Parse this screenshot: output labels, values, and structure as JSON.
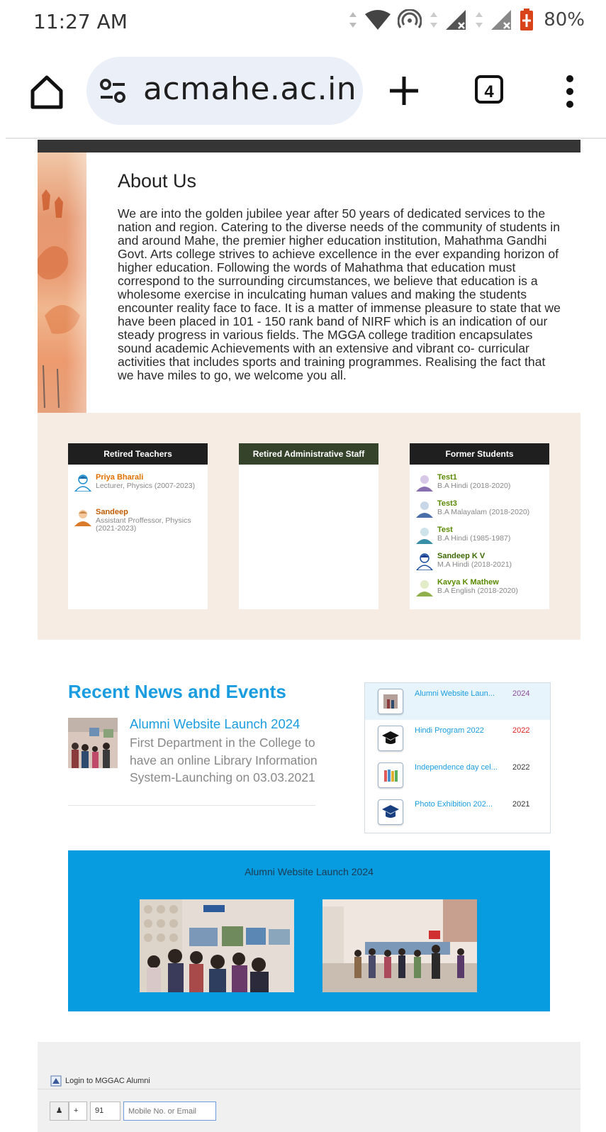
{
  "status_bar": {
    "time": "11:27 AM",
    "battery": "80%"
  },
  "browser": {
    "url": "acmahe.ac.in",
    "tab_count": "4"
  },
  "about": {
    "title": "About Us",
    "text": "We are into the golden jubilee year after 50 years of dedicated services to the nation and region. Catering to the diverse needs of the community of students in and around Mahe, the premier higher education institution, Mahathma Gandhi Govt. Arts college strives to achieve excellence in the ever expanding horizon of higher education. Following the words of Mahathma that education must correspond to the surrounding circumstances, we believe that education is a wholesome exercise in inculcating human values and making the students encounter reality face to face. It is a matter of immense pleasure to state that we have been placed in 101 - 150 rank band of NIRF which is an indication of our steady progress in various fields. The MGGA college tradition encapsulates sound academic Achievements with an extensive and vibrant co- curricular activities that includes sports and training programmes. Realising the fact that we have miles to go, we welcome you all."
  },
  "cards": [
    {
      "title": "Retired Teachers",
      "color": "#1f1f1f",
      "people": [
        {
          "name": "Priya Bharali",
          "desc": "Lecturer, Physics (2007-2023)",
          "name_color": "#e07000",
          "avatar": "female-avatar-icon"
        },
        {
          "name": "Sandeep",
          "desc": "Assistant Proffessor, Physics (2021-2023)",
          "name_color": "#c05a00",
          "avatar": "male-avatar-icon"
        }
      ]
    },
    {
      "title": "Retired Administrative Staff",
      "color": "#34432a",
      "people": []
    },
    {
      "title": "Former Students",
      "color": "#1f1f1f",
      "people": [
        {
          "name": "Test1",
          "desc": "B.A Hindi (2018-2020)",
          "name_color": "#5a8a00",
          "avatar": "male-avatar-icon"
        },
        {
          "name": "Test3",
          "desc": "B.A Malayalam (2018-2020)",
          "name_color": "#5a8a00",
          "avatar": "male-avatar-icon"
        },
        {
          "name": "Test",
          "desc": "B.A Hindi (1985-1987)",
          "name_color": "#5a8a00",
          "avatar": "male-avatar-icon"
        },
        {
          "name": "Sandeep K V",
          "desc": "M.A Hindi (2018-2021)",
          "name_color": "#3d6a00",
          "avatar": "female-avatar-icon"
        },
        {
          "name": "Kavya K Mathew",
          "desc": "B.A English (2018-2020)",
          "name_color": "#5a8a00",
          "avatar": "female-avatar-icon"
        }
      ]
    }
  ],
  "news": {
    "title": "Recent News and Events",
    "featured": {
      "headline": "Alumni Website Launch 2024",
      "description": "First Department in the College to have an online Library Information System-Launching on 03.03.2021"
    },
    "events": [
      {
        "label": "Alumni Website Laun...",
        "year": "2024",
        "year_color": "#8a4a9a",
        "icon": "photo-icon",
        "highlight": true
      },
      {
        "label": "Hindi Program 2022",
        "year": "2022",
        "year_color": "#e02020",
        "icon": "graduation-cap-icon",
        "highlight": false
      },
      {
        "label": "Independence day cel...",
        "year": "2022",
        "year_color": "#333333",
        "icon": "books-icon",
        "highlight": false
      },
      {
        "label": "Photo Exhibition 202...",
        "year": "2021",
        "year_color": "#333333",
        "icon": "graduation-cap-icon",
        "highlight": false
      }
    ]
  },
  "banner": {
    "caption": "Alumni Website Launch 2024"
  },
  "login": {
    "title": "Login to MGGAC Alumni",
    "plus": "+",
    "country_code": "91",
    "placeholder": "Mobile No. or Email"
  }
}
